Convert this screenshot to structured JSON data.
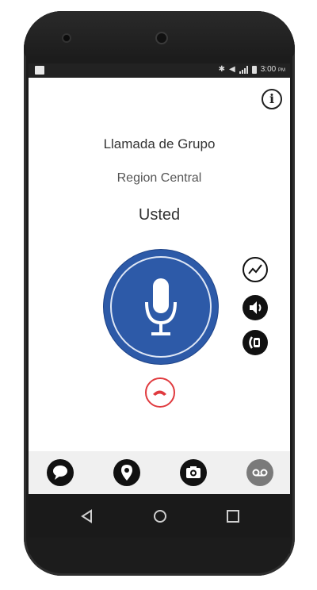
{
  "status_bar": {
    "time": "3:00",
    "ampm": "PM"
  },
  "call": {
    "title": "Llamada de Grupo",
    "group": "Region Central",
    "speaker": "Usted"
  },
  "icons": {
    "info": "info-icon",
    "ptt": "microphone-icon",
    "graph": "activity-icon",
    "volume": "speaker-volume-icon",
    "audio_route": "audio-output-icon",
    "hangup": "phone-hangup-icon",
    "tabs": [
      "chat-bubble-icon",
      "location-pin-icon",
      "camera-icon",
      "voicemail-icon"
    ],
    "nav": [
      "back-icon",
      "home-icon",
      "recents-icon"
    ]
  },
  "colors": {
    "ptt_blue": "#2d5aa8",
    "hangup_red": "#e03a3e",
    "voicemail_gray": "#7a7a7a"
  }
}
